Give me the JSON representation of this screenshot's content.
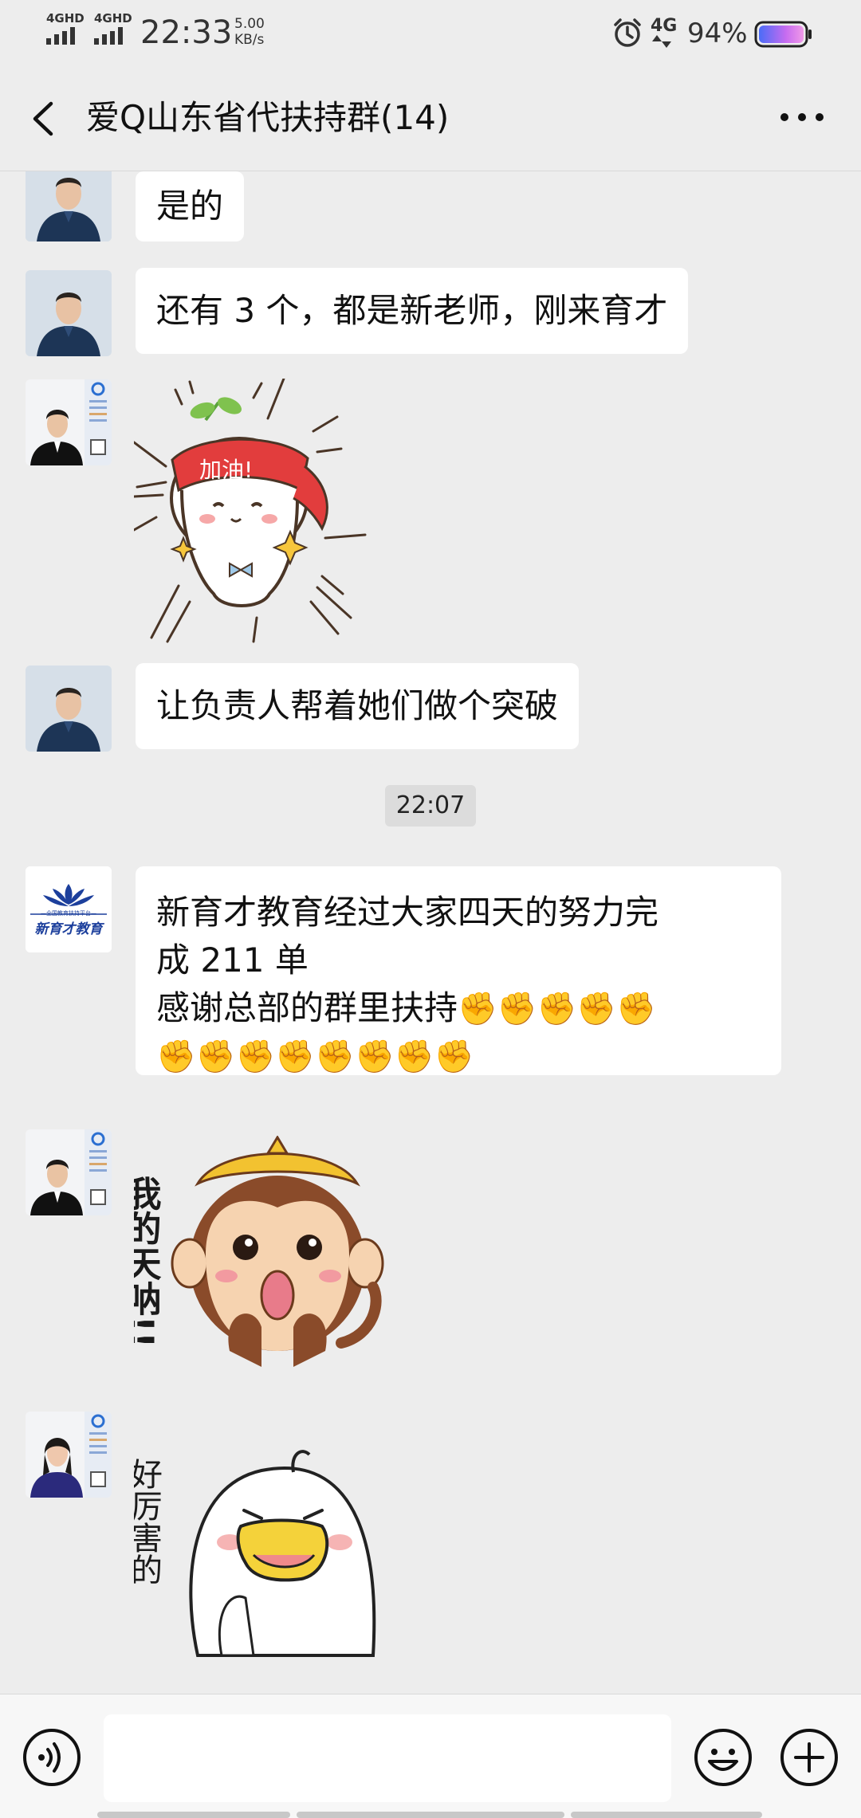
{
  "status": {
    "net1": "4GHD",
    "net2": "4GHD",
    "time": "22:33",
    "speed_value": "5.00",
    "speed_unit": "KB/s",
    "signal": "4G",
    "battery": "94%"
  },
  "header": {
    "title": "爱Q山东省代扶持群(14)"
  },
  "messages": [
    {
      "text": "是的"
    },
    {
      "text": "还有 3 个，都是新老师，刚来育才"
    },
    {
      "sticker_text": "加油!"
    },
    {
      "text": "让负责人帮着她们做个突破"
    },
    {
      "timestamp": "22:07"
    },
    {
      "avatar_text_top": "—全国教育扶持平台—",
      "avatar_text_bottom": "新育才教育",
      "line1": "新育才教育经过大家四天的努力完",
      "line2": "成 211 单",
      "line3": "感谢总部的群里扶持",
      "fists1": "✊✊✊✊✊",
      "fists2": "✊✊✊✊✊✊✊✊"
    },
    {
      "sticker_text": "我的天呐!!"
    },
    {
      "sticker_text": "好厉害的"
    }
  ],
  "colors": {
    "background": "#ededed",
    "bubble": "#ffffff",
    "accent_blue": "#1c3f9c"
  }
}
